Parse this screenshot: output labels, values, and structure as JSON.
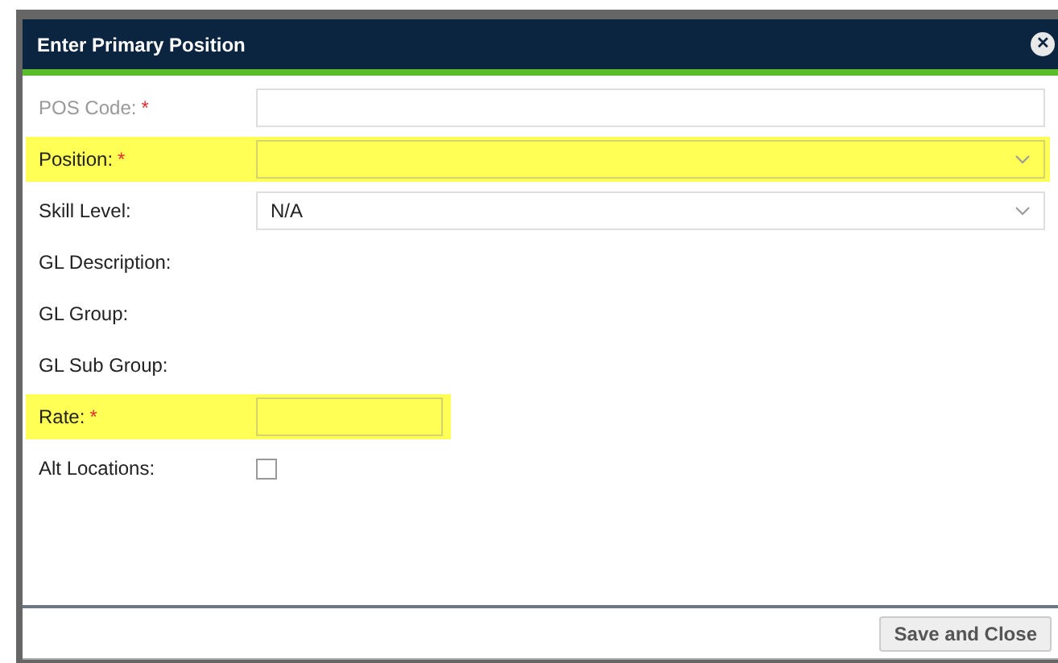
{
  "dialog": {
    "title": "Enter Primary Position",
    "close_glyph": "✕"
  },
  "fields": [
    {
      "kind": "text",
      "label": "POS Code:",
      "required_mark": "*",
      "disabled": true,
      "highlighted": false
    },
    {
      "kind": "select",
      "label": "Position:",
      "required_mark": "*",
      "disabled": false,
      "highlighted": true
    },
    {
      "kind": "select",
      "label": "Skill Level:",
      "disabled": false,
      "highlighted": false,
      "value": "N/A"
    },
    {
      "kind": "static",
      "label": "GL Description:",
      "disabled": false,
      "highlighted": false
    },
    {
      "kind": "static",
      "label": "GL Group:",
      "disabled": false,
      "highlighted": false
    },
    {
      "kind": "static",
      "label": "GL Sub Group:",
      "disabled": false,
      "highlighted": false
    },
    {
      "kind": "short",
      "label": "Rate:",
      "required_mark": "*",
      "disabled": false,
      "highlighted": true
    },
    {
      "kind": "checkbox",
      "label": "Alt Locations:",
      "disabled": false,
      "highlighted": false,
      "checked": false
    }
  ],
  "buttons": [
    "Save and Close"
  ]
}
